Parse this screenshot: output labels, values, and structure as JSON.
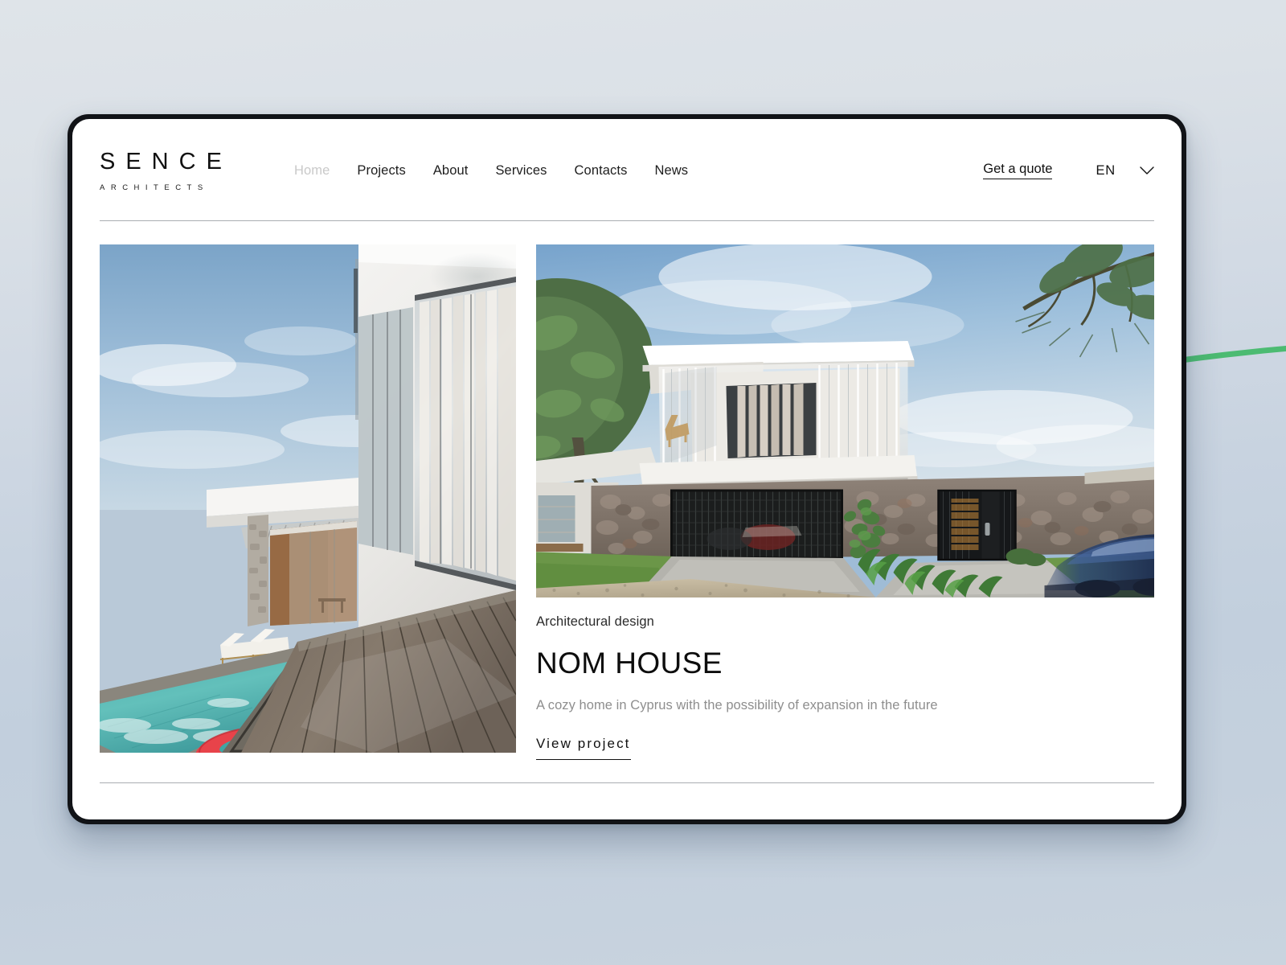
{
  "brand": {
    "wordmark": "SENCE",
    "subtitle": "ARCHITECTS"
  },
  "nav": {
    "items": [
      {
        "label": "Home",
        "active": true
      },
      {
        "label": "Projects",
        "active": false
      },
      {
        "label": "About",
        "active": false
      },
      {
        "label": "Services",
        "active": false
      },
      {
        "label": "Contacts",
        "active": false
      },
      {
        "label": "News",
        "active": false
      }
    ]
  },
  "header_actions": {
    "quote_label": "Get a quote",
    "language_code": "EN",
    "chevron_icon": "chevron-down-icon"
  },
  "project": {
    "category": "Architectural design",
    "title": "NOM HOUSE",
    "description": "A cozy home in Cyprus with the possibility of expansion in the future",
    "cta_label": "View project",
    "image_left_alt": "Pool terrace with wooden deck and red float",
    "image_hero_alt": "Modern two-storey house with stone wall and glass upper volume"
  },
  "colors": {
    "page_background_top": "#dfe4e9",
    "page_background_bottom": "#c9d4df",
    "device_frame": "#111317",
    "viewport_background": "#ffffff",
    "text_primary": "#111111",
    "text_muted": "#8e8e8e",
    "nav_active": "#c9c9c9",
    "rule": "#a9adb2",
    "accent_wire": "#4cbb72"
  }
}
